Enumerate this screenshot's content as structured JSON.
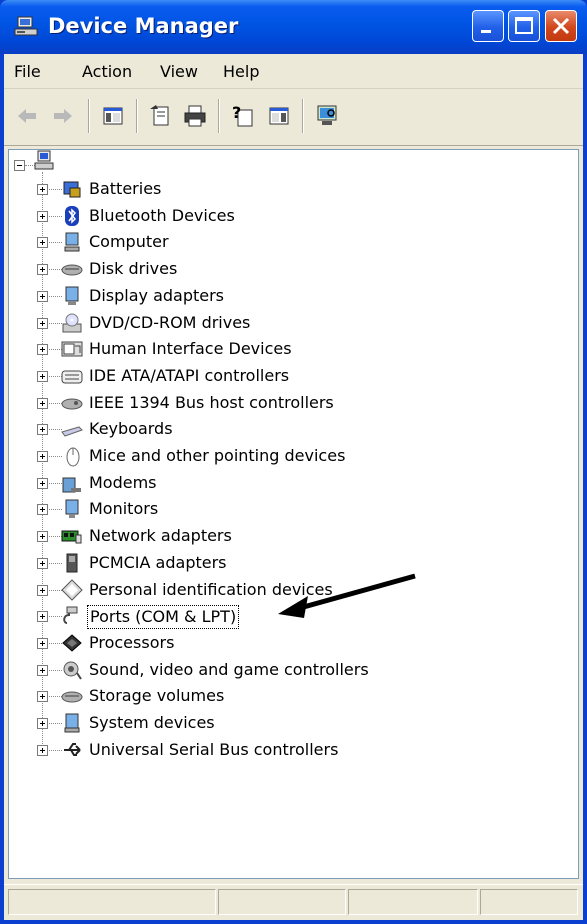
{
  "window": {
    "title": "Device Manager"
  },
  "menubar": {
    "items": [
      {
        "label": "File"
      },
      {
        "label": "Action"
      },
      {
        "label": "View"
      },
      {
        "label": "Help"
      }
    ]
  },
  "toolbar": {
    "buttons": [
      {
        "icon": "back-arrow-icon"
      },
      {
        "icon": "forward-arrow-icon"
      },
      {
        "icon": "show-hide-console-tree-icon"
      },
      {
        "icon": "properties-icon"
      },
      {
        "icon": "print-icon"
      },
      {
        "icon": "help-icon"
      },
      {
        "icon": "show-hide-action-pane-icon"
      },
      {
        "icon": "scan-hardware-icon"
      }
    ]
  },
  "tree": {
    "root_icon": "computer-icon",
    "items": [
      {
        "label": "Batteries",
        "icon": "battery-icon"
      },
      {
        "label": "Bluetooth Devices",
        "icon": "bluetooth-icon"
      },
      {
        "label": "Computer",
        "icon": "computer-icon"
      },
      {
        "label": "Disk drives",
        "icon": "disk-drive-icon"
      },
      {
        "label": "Display adapters",
        "icon": "display-adapter-icon"
      },
      {
        "label": "DVD/CD-ROM drives",
        "icon": "cdrom-icon"
      },
      {
        "label": "Human Interface Devices",
        "icon": "hid-icon"
      },
      {
        "label": "IDE ATA/ATAPI controllers",
        "icon": "ide-controller-icon"
      },
      {
        "label": "IEEE 1394 Bus host controllers",
        "icon": "ieee1394-icon"
      },
      {
        "label": "Keyboards",
        "icon": "keyboard-icon"
      },
      {
        "label": "Mice and other pointing devices",
        "icon": "mouse-icon"
      },
      {
        "label": "Modems",
        "icon": "modem-icon"
      },
      {
        "label": "Monitors",
        "icon": "monitor-icon"
      },
      {
        "label": "Network adapters",
        "icon": "network-adapter-icon"
      },
      {
        "label": "PCMCIA adapters",
        "icon": "pcmcia-icon"
      },
      {
        "label": "Personal identification devices",
        "icon": "identification-device-icon"
      },
      {
        "label": "Ports (COM & LPT)",
        "icon": "port-icon",
        "selected": true
      },
      {
        "label": "Processors",
        "icon": "processor-icon"
      },
      {
        "label": "Sound, video and game controllers",
        "icon": "sound-icon"
      },
      {
        "label": "Storage volumes",
        "icon": "storage-volume-icon"
      },
      {
        "label": "System devices",
        "icon": "system-device-icon"
      },
      {
        "label": "Universal Serial Bus controllers",
        "icon": "usb-icon"
      }
    ]
  },
  "colors": {
    "titlebar": "#0054e3",
    "close_button": "#d1471d",
    "chrome": "#ece9d8",
    "annotation_arrow": "#000000"
  }
}
